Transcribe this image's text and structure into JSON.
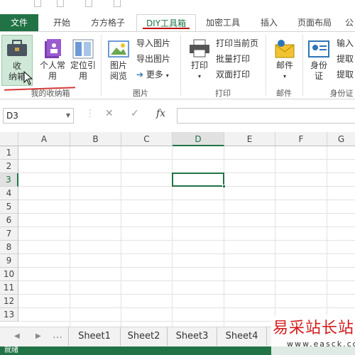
{
  "tabs": [
    {
      "label": "文件",
      "key": "file"
    },
    {
      "label": "开始",
      "key": "home"
    },
    {
      "label": "方方格子",
      "key": "ff"
    },
    {
      "label": "DIY工具箱",
      "key": "diy"
    },
    {
      "label": "加密工具",
      "key": "encrypt"
    },
    {
      "label": "插入",
      "key": "insert"
    },
    {
      "label": "页面布局",
      "key": "layout"
    },
    {
      "label": "公",
      "key": "formula"
    }
  ],
  "ribbon": {
    "collect": {
      "label_line1": "收",
      "label_line2": "纳箱"
    },
    "personal": {
      "label_line1": "个人常",
      "label_line2": "用"
    },
    "locate": {
      "label_line1": "定位引",
      "label_line2": "用"
    },
    "group_mybox": "我的收纳箱",
    "pic_browse": {
      "label_line1": "图片",
      "label_line2": "阅览"
    },
    "import_pic": "导入图片",
    "export_pic": "导出图片",
    "more": "更多",
    "group_pic": "图片",
    "print": {
      "label": "打印"
    },
    "print_current": "打印当前页",
    "batch_print": "批量打印",
    "duplex_print": "双面打印",
    "group_print": "打印",
    "mail": {
      "label": "邮件"
    },
    "group_mail": "邮件",
    "idcard": {
      "label_line1": "身份",
      "label_line2": "证"
    },
    "input_more": "输入",
    "extract1": "提取",
    "extract2": "提取",
    "group_id": "身份证"
  },
  "formula_bar": {
    "name_box": "D3",
    "fx": "fx",
    "cancel": "✕",
    "confirm": "✓",
    "value": ""
  },
  "grid": {
    "columns": [
      "A",
      "B",
      "C",
      "D",
      "E",
      "F",
      "G"
    ],
    "rows": [
      "1",
      "2",
      "3",
      "4",
      "5",
      "6",
      "7",
      "8",
      "9",
      "10",
      "11",
      "12",
      "13"
    ],
    "selected_col": "D",
    "selected_row": "3"
  },
  "sheets": [
    "Sheet1",
    "Sheet2",
    "Sheet3",
    "Sheet4"
  ],
  "status": {
    "text": "就绪"
  },
  "watermark": {
    "title": "易采站长站",
    "url": "www.easck.com"
  },
  "colors": {
    "accent": "#217346",
    "red": "#c00000"
  }
}
